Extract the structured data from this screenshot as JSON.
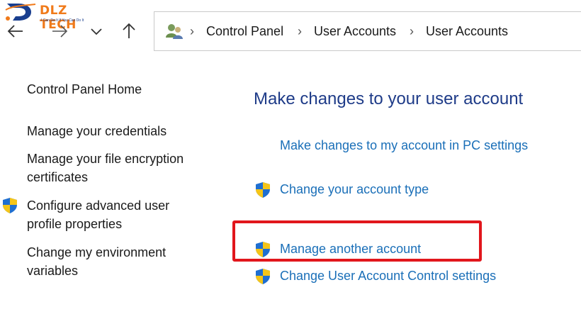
{
  "logo": {
    "title": "DLZ TECH",
    "tagline": "I Can Do It If You Can Do It"
  },
  "address": {
    "crumbs": [
      "Control Panel",
      "User Accounts",
      "User Accounts"
    ]
  },
  "sidebar": {
    "home": "Control Panel Home",
    "items": [
      {
        "label": "Manage your credentials"
      },
      {
        "label": "Manage your file encryption certificates"
      },
      {
        "label": "Configure advanced user profile properties",
        "shield": true
      },
      {
        "label": "Change my environment variables"
      }
    ]
  },
  "main": {
    "title": "Make changes to your user account",
    "tasks": [
      {
        "label": "Make changes to my account in PC settings",
        "shield": false
      },
      {
        "label": "Change your account type",
        "shield": true
      },
      {
        "label": "Manage another account",
        "shield": true,
        "highlighted": true
      },
      {
        "label": "Change User Account Control settings",
        "shield": true
      }
    ]
  },
  "colors": {
    "link": "#1a6fb8",
    "title": "#1e3b88",
    "highlight": "#e1161c",
    "logo_orange": "#f07a1a",
    "logo_blue": "#1a3f8f"
  },
  "icons": [
    "back-arrow-icon",
    "forward-arrow-icon",
    "chevron-down-icon",
    "up-arrow-icon",
    "users-icon",
    "uac-shield-icon"
  ]
}
